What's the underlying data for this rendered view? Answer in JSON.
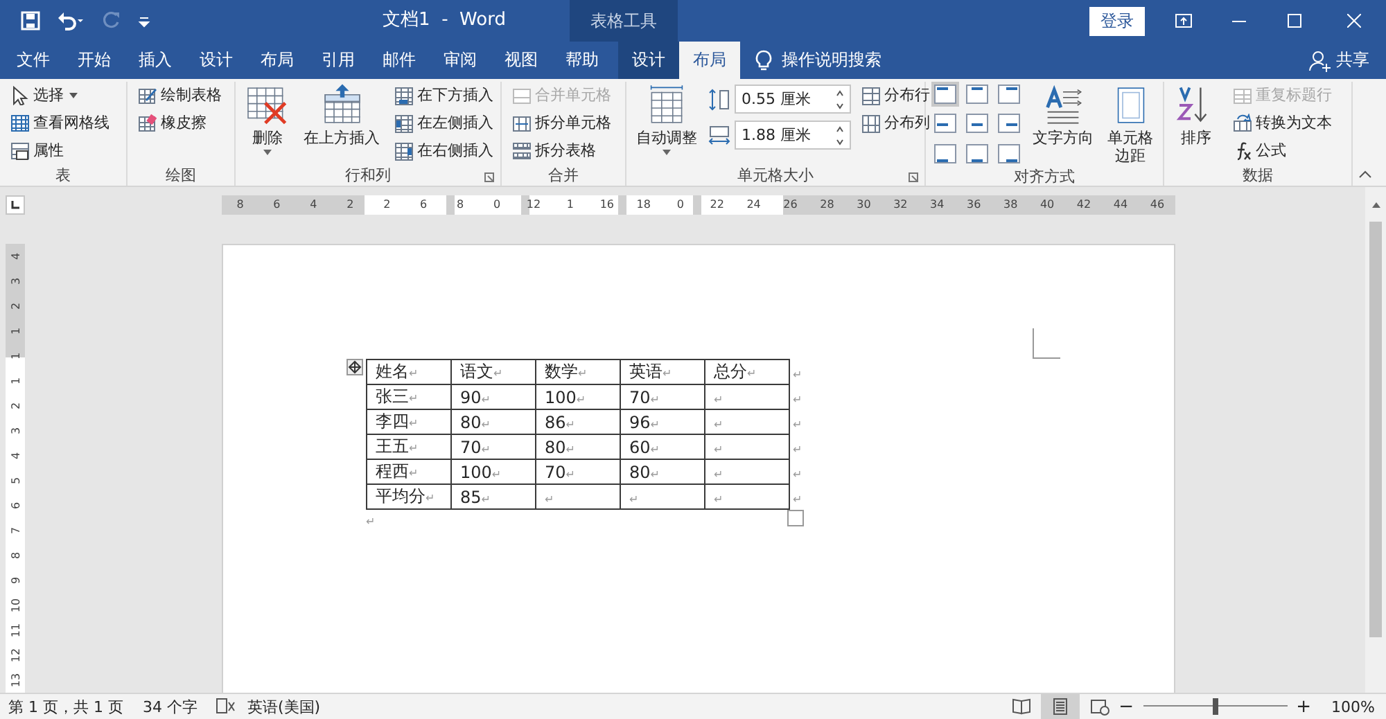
{
  "title_bar": {
    "quick_access": [
      {
        "kind": "save",
        "disabled": false
      },
      {
        "kind": "undo",
        "disabled": false
      },
      {
        "kind": "redo",
        "disabled": true
      },
      {
        "kind": "customize",
        "disabled": false
      }
    ],
    "title": "文档1  -  Word",
    "context_label": "表格工具",
    "sign_in": "登录"
  },
  "tabs": [
    {
      "label": "文件",
      "selected": false,
      "context": false
    },
    {
      "label": "开始",
      "selected": false,
      "context": false
    },
    {
      "label": "插入",
      "selected": false,
      "context": false
    },
    {
      "label": "设计",
      "selected": false,
      "context": false
    },
    {
      "label": "布局",
      "selected": false,
      "context": false
    },
    {
      "label": "引用",
      "selected": false,
      "context": false
    },
    {
      "label": "邮件",
      "selected": false,
      "context": false
    },
    {
      "label": "审阅",
      "selected": false,
      "context": false
    },
    {
      "label": "视图",
      "selected": false,
      "context": false
    },
    {
      "label": "帮助",
      "selected": false,
      "context": false
    },
    {
      "label": "设计",
      "selected": false,
      "context": true
    },
    {
      "label": "布局",
      "selected": true,
      "context": true
    }
  ],
  "tell_me": "操作说明搜索",
  "share": "共享",
  "ribbon": {
    "groups": [
      {
        "label": "表",
        "launcher": false,
        "columns": [
          [
            {
              "kind": "small",
              "label": "选择",
              "dropdown": true,
              "disabled": false
            },
            {
              "kind": "small",
              "label": "查看网格线",
              "dropdown": false,
              "disabled": false
            },
            {
              "kind": "small",
              "label": "属性",
              "dropdown": false,
              "disabled": false
            }
          ]
        ]
      },
      {
        "label": "绘图",
        "launcher": false,
        "columns": [
          [
            {
              "kind": "small",
              "label": "绘制表格",
              "dropdown": false,
              "disabled": false
            },
            {
              "kind": "small",
              "label": "橡皮擦",
              "dropdown": false,
              "disabled": false
            }
          ]
        ]
      },
      {
        "label": "行和列",
        "launcher": true,
        "columns": [
          [
            {
              "kind": "large",
              "label": "删除",
              "dropdown": true,
              "disabled": false
            }
          ],
          [
            {
              "kind": "large",
              "label": "在上方插入",
              "dropdown": false,
              "disabled": false
            }
          ],
          [
            {
              "kind": "small",
              "label": "在下方插入",
              "dropdown": false,
              "disabled": false
            },
            {
              "kind": "small",
              "label": "在左侧插入",
              "dropdown": false,
              "disabled": false
            },
            {
              "kind": "small",
              "label": "在右侧插入",
              "dropdown": false,
              "disabled": false
            }
          ]
        ]
      },
      {
        "label": "合并",
        "launcher": false,
        "columns": [
          [
            {
              "kind": "small",
              "label": "合并单元格",
              "dropdown": false,
              "disabled": true
            },
            {
              "kind": "small",
              "label": "拆分单元格",
              "dropdown": false,
              "disabled": false
            },
            {
              "kind": "small",
              "label": "拆分表格",
              "dropdown": false,
              "disabled": false
            }
          ]
        ]
      },
      {
        "label": "单元格大小",
        "launcher": true,
        "columns": [
          [
            {
              "kind": "large",
              "label": "自动调整",
              "dropdown": true,
              "disabled": false
            }
          ],
          [
            {
              "kind": "spin",
              "value": "0.55 厘米"
            },
            {
              "kind": "spin",
              "value": "1.88 厘米"
            }
          ],
          [
            {
              "kind": "small",
              "label": "分布行",
              "dropdown": false,
              "disabled": false
            },
            {
              "kind": "small",
              "label": "分布列",
              "dropdown": false,
              "disabled": false
            }
          ]
        ]
      },
      {
        "label": "对齐方式",
        "launcher": false,
        "columns": [
          [
            {
              "kind": "align",
              "cells": [
                {
                  "selected": true
                },
                {
                  "selected": false
                },
                {
                  "selected": false
                },
                {
                  "selected": false
                },
                {
                  "selected": false
                },
                {
                  "selected": false
                },
                {
                  "selected": false
                },
                {
                  "selected": false
                },
                {
                  "selected": false
                }
              ]
            }
          ],
          [
            {
              "kind": "large",
              "label": "文字方向",
              "dropdown": false,
              "disabled": false
            }
          ],
          [
            {
              "kind": "large",
              "lines": [
                "单元格",
                "边距"
              ],
              "dropdown": false,
              "disabled": false
            }
          ]
        ]
      },
      {
        "label": "数据",
        "launcher": false,
        "columns": [
          [
            {
              "kind": "large",
              "label": "排序",
              "dropdown": false,
              "disabled": false
            }
          ],
          [
            {
              "kind": "small",
              "label": "重复标题行",
              "dropdown": false,
              "disabled": true
            },
            {
              "kind": "small",
              "label": "转换为文本",
              "dropdown": false,
              "disabled": false
            },
            {
              "kind": "small",
              "label": "公式",
              "dropdown": false,
              "disabled": false
            }
          ]
        ]
      }
    ]
  },
  "ruler": {
    "horizontal": [
      "8",
      "6",
      "4",
      "2",
      "2",
      "6",
      "8",
      "0",
      "12",
      "1",
      "16",
      "18",
      "0",
      "22",
      "24",
      "26",
      "28",
      "30",
      "32",
      "34",
      "36",
      "38",
      "40",
      "42",
      "44",
      "46"
    ],
    "vertical": [
      "4",
      "3",
      "2",
      "1",
      "1",
      "1",
      "2",
      "3",
      "4",
      "5",
      "6",
      "7",
      "8",
      "9",
      "10",
      "11",
      "12",
      "13"
    ]
  },
  "document": {
    "mark": "↵",
    "table": {
      "columns": [
        "姓名",
        "语文",
        "数学",
        "英语",
        "总分"
      ],
      "rows": [
        [
          "张三",
          "90",
          "100",
          "70",
          ""
        ],
        [
          "李四",
          "80",
          "86",
          "96",
          ""
        ],
        [
          "王五",
          "70",
          "80",
          "60",
          ""
        ],
        [
          "程西",
          "100",
          "70",
          "80",
          ""
        ],
        [
          "平均分",
          "85",
          "",
          "",
          ""
        ]
      ]
    }
  },
  "status_bar": {
    "page": "第 1 页，共 1 页",
    "words": "34 个字",
    "language": "英语(美国)",
    "views": [
      {
        "selected": false
      },
      {
        "selected": true
      },
      {
        "selected": false
      }
    ],
    "zoom_out": "−",
    "zoom_in": "+",
    "zoom": {
      "level": 0.5,
      "reading": "100%"
    }
  }
}
